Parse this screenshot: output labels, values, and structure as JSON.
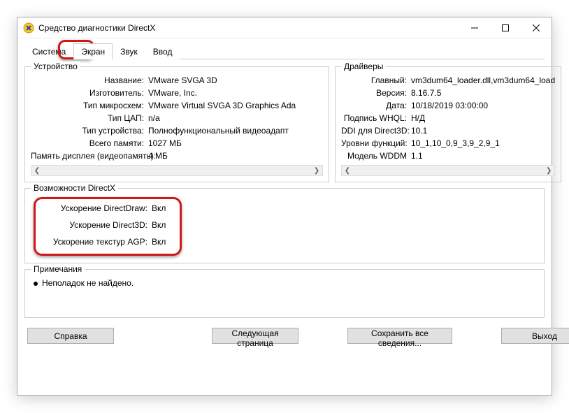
{
  "window": {
    "title": "Средство диагностики DirectX"
  },
  "tabs": {
    "system": "Система",
    "screen": "Экран",
    "sound": "Звук",
    "input": "Ввод"
  },
  "device": {
    "legend": "Устройство",
    "name_k": "Название:",
    "name_v": "VMware SVGA 3D",
    "mfr_k": "Изготовитель:",
    "mfr_v": "VMware, Inc.",
    "chip_k": "Тип микросхем:",
    "chip_v": "VMware Virtual SVGA 3D Graphics Ada",
    "dac_k": "Тип ЦАП:",
    "dac_v": "n/a",
    "devtype_k": "Тип устройства:",
    "devtype_v": "Полнофункциональный видеоадапт",
    "totmem_k": "Всего памяти:",
    "totmem_v": "1027 МБ",
    "dispmem_k": "Память дисплея (видеопамять):",
    "dispmem_v": "4 МБ"
  },
  "drivers": {
    "legend": "Драйверы",
    "main_k": "Главный:",
    "main_v": "vm3dum64_loader.dll,vm3dum64_load",
    "ver_k": "Версия:",
    "ver_v": "8.16.7.5",
    "date_k": "Дата:",
    "date_v": "10/18/2019 03:00:00",
    "whql_k": "Подпись WHQL:",
    "whql_v": "Н/Д",
    "ddi_k": "DDI для Direct3D:",
    "ddi_v": "10.1",
    "feat_k": "Уровни функций:",
    "feat_v": "10_1,10_0,9_3,9_2,9_1",
    "wddm_k": "Модель WDDM",
    "wddm_v": "1.1"
  },
  "caps": {
    "legend": "Возможности DirectX",
    "ddraw_k": "Ускорение DirectDraw:",
    "ddraw_v": "Вкл",
    "d3d_k": "Ускорение Direct3D:",
    "d3d_v": "Вкл",
    "agp_k": "Ускорение текстур AGP:",
    "agp_v": "Вкл"
  },
  "notes": {
    "legend": "Примечания",
    "line1": "Неполадок не найдено."
  },
  "footer": {
    "help": "Справка",
    "next": "Следующая страница",
    "save": "Сохранить все сведения...",
    "exit": "Выход"
  }
}
